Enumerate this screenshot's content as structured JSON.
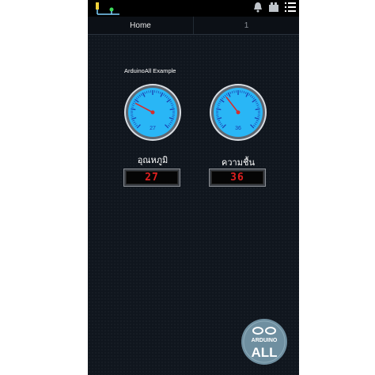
{
  "colors": {
    "background": "#10161e",
    "gauge_face": "#29b6f6",
    "gauge_ticks": "#1a3fb0",
    "needle": "#d32f2f",
    "led_text": "#e02020",
    "logo_bg": "#6f8fa0"
  },
  "status_icons": [
    "usb-connection-icon",
    "bell-icon",
    "battery-icon",
    "overflow-menu-icon"
  ],
  "tabs": [
    {
      "label": "Home"
    },
    {
      "label": "1"
    }
  ],
  "app": {
    "title": "ArduinoAll Example"
  },
  "gauges": [
    {
      "label": "อุณหภูมิ",
      "value": "27",
      "display": "27",
      "level": 27
    },
    {
      "label": "ความชื้น",
      "value": "36",
      "display": "36",
      "level": 36
    }
  ],
  "logo": {
    "line1": "ARDUINO",
    "line2": "ALL"
  }
}
